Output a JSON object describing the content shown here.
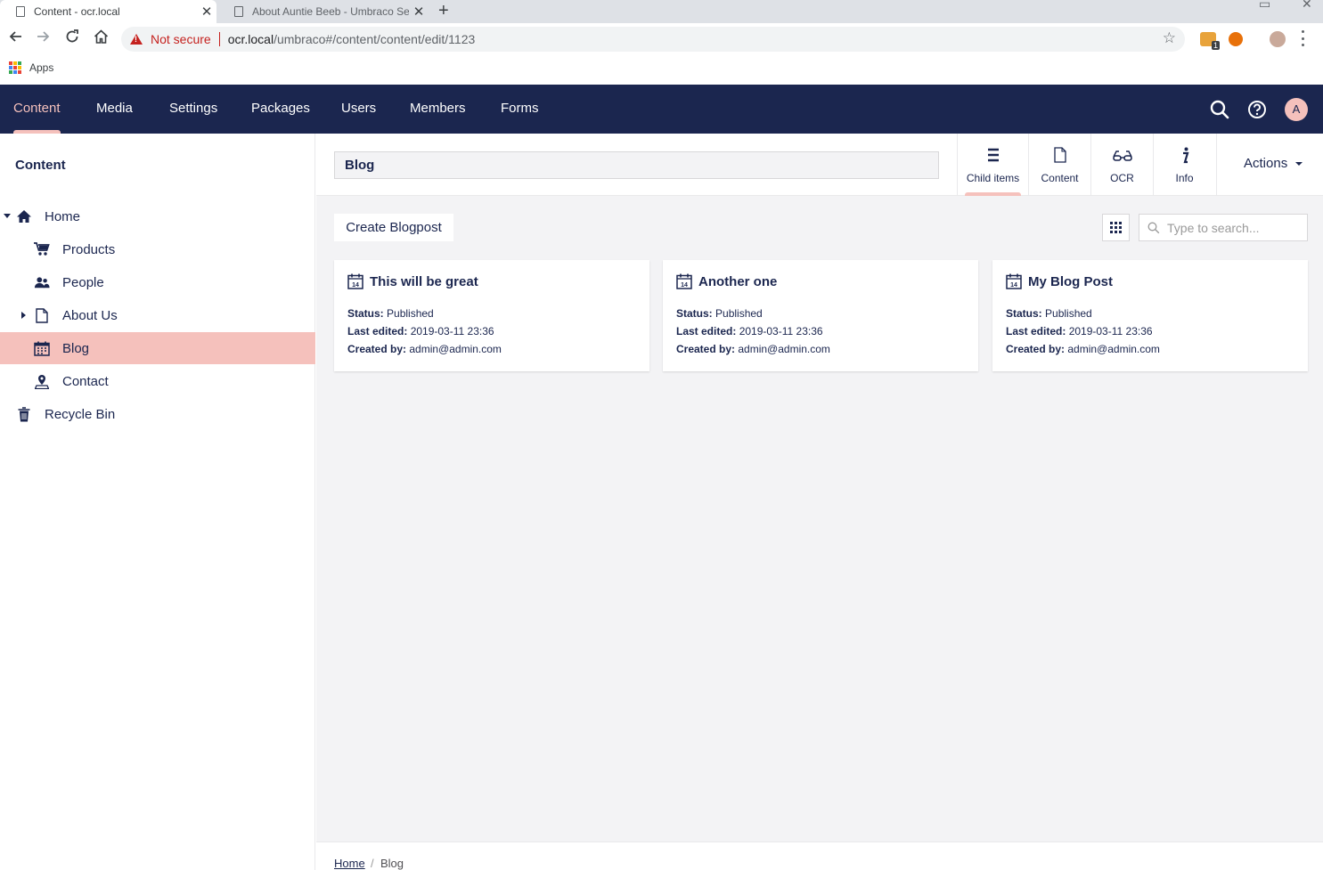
{
  "browser": {
    "tabs": [
      {
        "title": "Content - ocr.local",
        "active": true
      },
      {
        "title": "About Auntie Beeb - Umbraco Se",
        "active": false
      }
    ],
    "security_label": "Not secure",
    "url_host": "ocr.local",
    "url_path": "/umbraco#/content/content/edit/1123",
    "bookmarks": {
      "apps_label": "Apps"
    },
    "extension_badge": "1"
  },
  "header": {
    "sections": [
      "Content",
      "Media",
      "Settings",
      "Packages",
      "Users",
      "Members",
      "Forms"
    ],
    "active_section": "Content",
    "avatar_initial": "A",
    "color": "#1b264f",
    "accent": "#f5c1bc"
  },
  "tree": {
    "title": "Content",
    "items": [
      {
        "label": "Home",
        "icon": "home-icon"
      },
      {
        "label": "Products",
        "icon": "cart-icon"
      },
      {
        "label": "People",
        "icon": "users-icon"
      },
      {
        "label": "About Us",
        "icon": "document-icon"
      },
      {
        "label": "Blog",
        "icon": "calendar-icon",
        "selected": true
      },
      {
        "label": "Contact",
        "icon": "map-pin-icon"
      },
      {
        "label": "Recycle Bin",
        "icon": "trash-icon"
      }
    ]
  },
  "editor": {
    "node_name": "Blog",
    "app_tabs": [
      {
        "label": "Child items",
        "icon": "list-icon",
        "active": true
      },
      {
        "label": "Content",
        "icon": "document-icon"
      },
      {
        "label": "OCR",
        "icon": "glasses-icon"
      },
      {
        "label": "Info",
        "icon": "info-icon"
      }
    ],
    "actions_label": "Actions",
    "create_label": "Create Blogpost",
    "search_placeholder": "Type to search...",
    "cards": [
      {
        "title": "This will be great",
        "status_label": "Status:",
        "status": "Published",
        "edited_label": "Last edited:",
        "edited": "2019-03-11 23:36",
        "created_label": "Created by:",
        "created": "admin@admin.com"
      },
      {
        "title": "Another one",
        "status_label": "Status:",
        "status": "Published",
        "edited_label": "Last edited:",
        "edited": "2019-03-11 23:36",
        "created_label": "Created by:",
        "created": "admin@admin.com"
      },
      {
        "title": "My Blog Post",
        "status_label": "Status:",
        "status": "Published",
        "edited_label": "Last edited:",
        "edited": "2019-03-11 23:36",
        "created_label": "Created by:",
        "created": "admin@admin.com"
      }
    ]
  },
  "breadcrumb": {
    "home": "Home",
    "separator": "/",
    "current": "Blog"
  }
}
